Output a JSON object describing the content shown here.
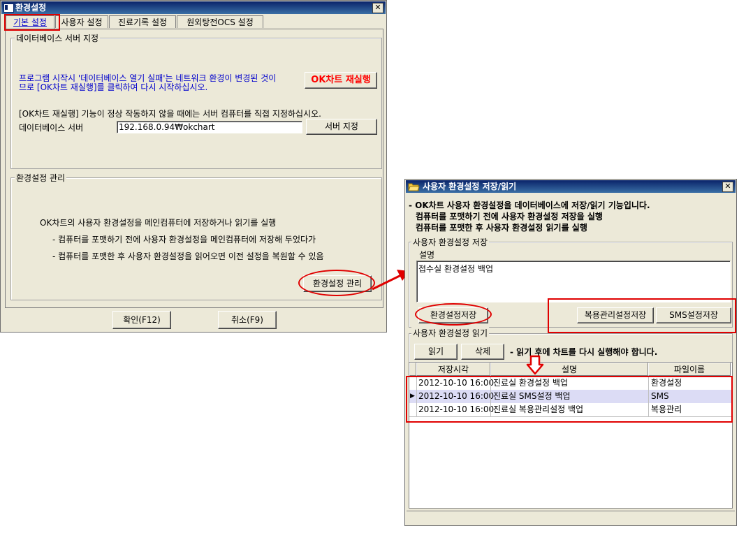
{
  "main_window": {
    "title": "환경설정",
    "tabs": [
      {
        "label": "기본 설정"
      },
      {
        "label": "사용자 설정"
      },
      {
        "label": "진료기록 설정"
      },
      {
        "label": "원외탕전OCS 설정"
      }
    ],
    "db_group": {
      "label": "데이터베이스 서버 지정",
      "notice_line1": "프로그램 시작시 '데이터베이스 열기 실패'는 네트워크 환경이 변경된 것이",
      "notice_line2": "므로 [OK차트 재실행]를 클릭하여 다시 시작하십시오.",
      "restart_button": "OK차트 재실행",
      "manual_hint": "[OK차트 재실행] 기능이 정상 작동하지 않을 때에는 서버 컴퓨터를 직접 지정하십시오.",
      "server_label": "데이터베이스 서버",
      "server_value": "192.168.0.94₩okchart",
      "server_button": "서버 지정"
    },
    "env_group": {
      "label": "환경설정 관리",
      "line1": "OK차트의 사용자 환경설정을 메인컴퓨터에 저장하거나 읽기를 실행",
      "line2": "- 컴퓨터를 포맷하기 전에 사용자 환경설정을 메인컴퓨터에 저장해 두었다가",
      "line3": "- 컴퓨터를 포맷한 후 사용자 환경설정을 읽어오면 이전 설정을 복원할 수 있음",
      "manage_button": "환경설정 관리"
    },
    "ok_button": "확인(F12)",
    "cancel_button": "취소(F9)"
  },
  "sub_window": {
    "title": "사용자 환경설정 저장/읽기",
    "intro_line1": "- OK차트 사용자 환경설정을 데이터베이스에 저장/읽기 기능입니다.",
    "intro_line2": "컴퓨터를 포맷하기 전에 사용자 환경설정 저장을 실행",
    "intro_line3": "컴퓨터를 포맷한 후 사용자 환경설정 읽기를 실행",
    "save_group": {
      "label": "사용자 환경설정 저장",
      "desc_label": "설명",
      "desc_value": "접수실 환경설정 백업",
      "save_button": "환경설정저장",
      "repeat_save_button": "복용관리설정저장",
      "sms_save_button": "SMS설정저장"
    },
    "read_group": {
      "label": "사용자 환경설정 읽기",
      "read_button": "읽기",
      "delete_button": "삭제",
      "notice": "- 읽기 후에 차트를 다시 실행해야 합니다.",
      "columns": [
        "저장시각",
        "설명",
        "파일이름"
      ],
      "rows": [
        {
          "time": "2012-10-10  16:00",
          "desc": "진료실 환경설정 백업",
          "file": "환경설정"
        },
        {
          "time": "2012-10-10  16:00",
          "desc": "진료실 SMS설정 백업",
          "file": "SMS"
        },
        {
          "time": "2012-10-10  16:00",
          "desc": "진료실 복용관리설정 백업",
          "file": "복용관리"
        }
      ]
    }
  },
  "colors": {
    "annotation_red": "#e00000",
    "notice_blue": "#0000cc",
    "restart_red": "#ff0000",
    "selected_row": "#dcdcf5"
  }
}
